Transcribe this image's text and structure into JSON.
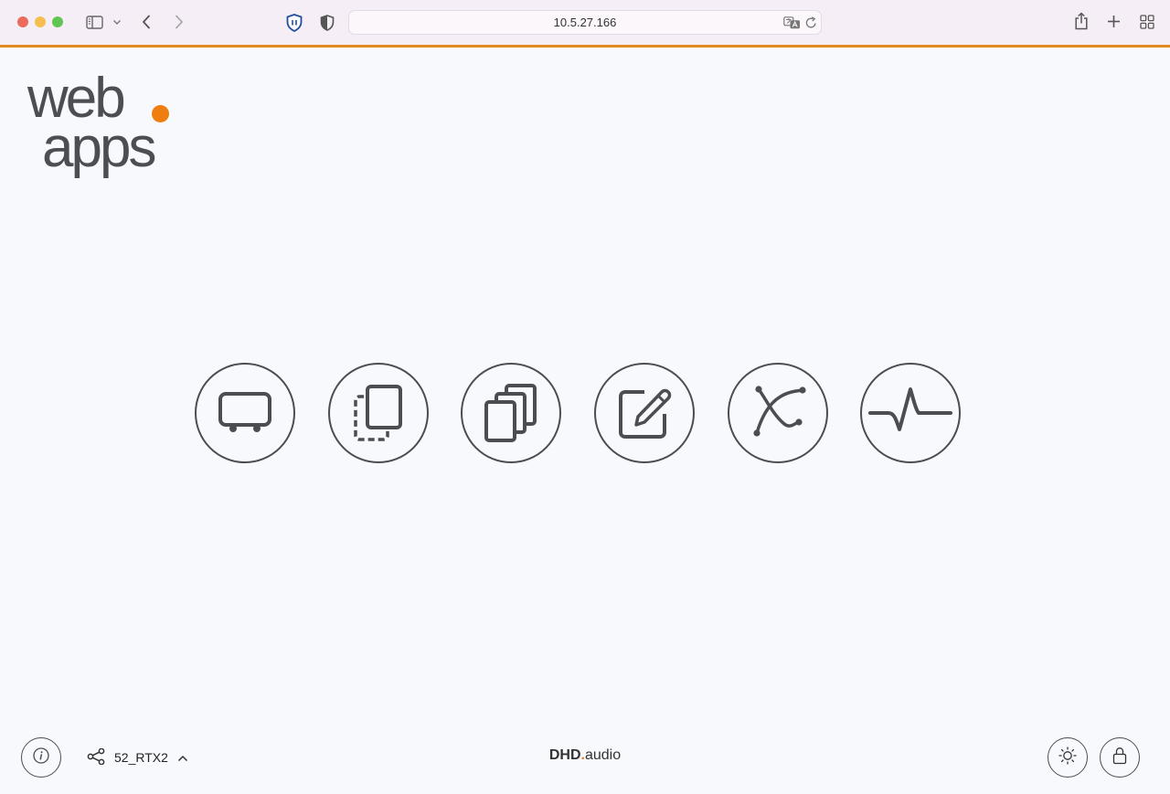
{
  "browser": {
    "url": "10.5.27.166",
    "traffic_colors": [
      "#ed6a5e",
      "#f5bf4f",
      "#61c554"
    ]
  },
  "logo": {
    "line1": "web",
    "line2": "apps",
    "dot_color": "#ef7d0f"
  },
  "apps": [
    {
      "icon": "device-icon"
    },
    {
      "icon": "copy-dashed-icon"
    },
    {
      "icon": "stack-pages-icon"
    },
    {
      "icon": "edit-icon"
    },
    {
      "icon": "curve-icon"
    },
    {
      "icon": "pulse-icon"
    }
  ],
  "footer": {
    "device_name": "52_RTX2",
    "brand_main": "DHD",
    "brand_dot": ".",
    "brand_suffix": "audio",
    "accent_color": "#e8821c"
  }
}
